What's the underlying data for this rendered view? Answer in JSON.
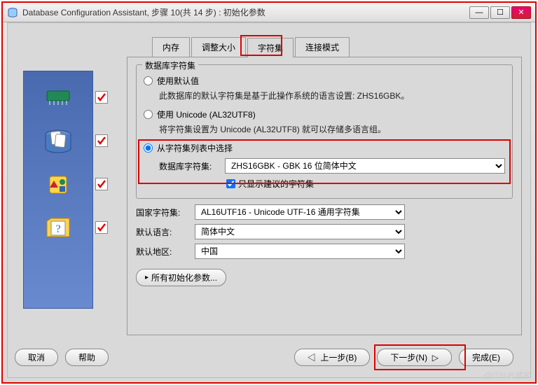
{
  "window": {
    "title": "Database Configuration Assistant, 步骤 10(共 14 步) : 初始化参数"
  },
  "tabs": {
    "memory": "内存",
    "sizing": "调整大小",
    "charset": "字符集",
    "connection": "连接模式"
  },
  "group": {
    "title": "数据库字符集",
    "opt_default": "使用默认值",
    "opt_default_desc": "此数据库的默认字符集是基于此操作系统的语言设置: ZHS16GBK。",
    "opt_unicode": "使用 Unicode (AL32UTF8)",
    "opt_unicode_desc": "将字符集设置为 Unicode (AL32UTF8) 就可以存储多语言组。",
    "opt_list": "从字符集列表中选择",
    "db_charset_label": "数据库字符集:",
    "db_charset_value": "ZHS16GBK - GBK 16 位简体中文",
    "only_recommended": "只显示建议的字符集"
  },
  "form": {
    "national_label": "国家字符集:",
    "national_value": "AL16UTF16 - Unicode UTF-16 通用字符集",
    "lang_label": "默认语言:",
    "lang_value": "简体中文",
    "region_label": "默认地区:",
    "region_value": "中国"
  },
  "all_params": "所有初始化参数...",
  "footer": {
    "cancel": "取消",
    "help": "帮助",
    "back": "上一步(B)",
    "next": "下一步(N)",
    "finish": "完成(E)"
  },
  "watermark": "@ITPUB博客"
}
